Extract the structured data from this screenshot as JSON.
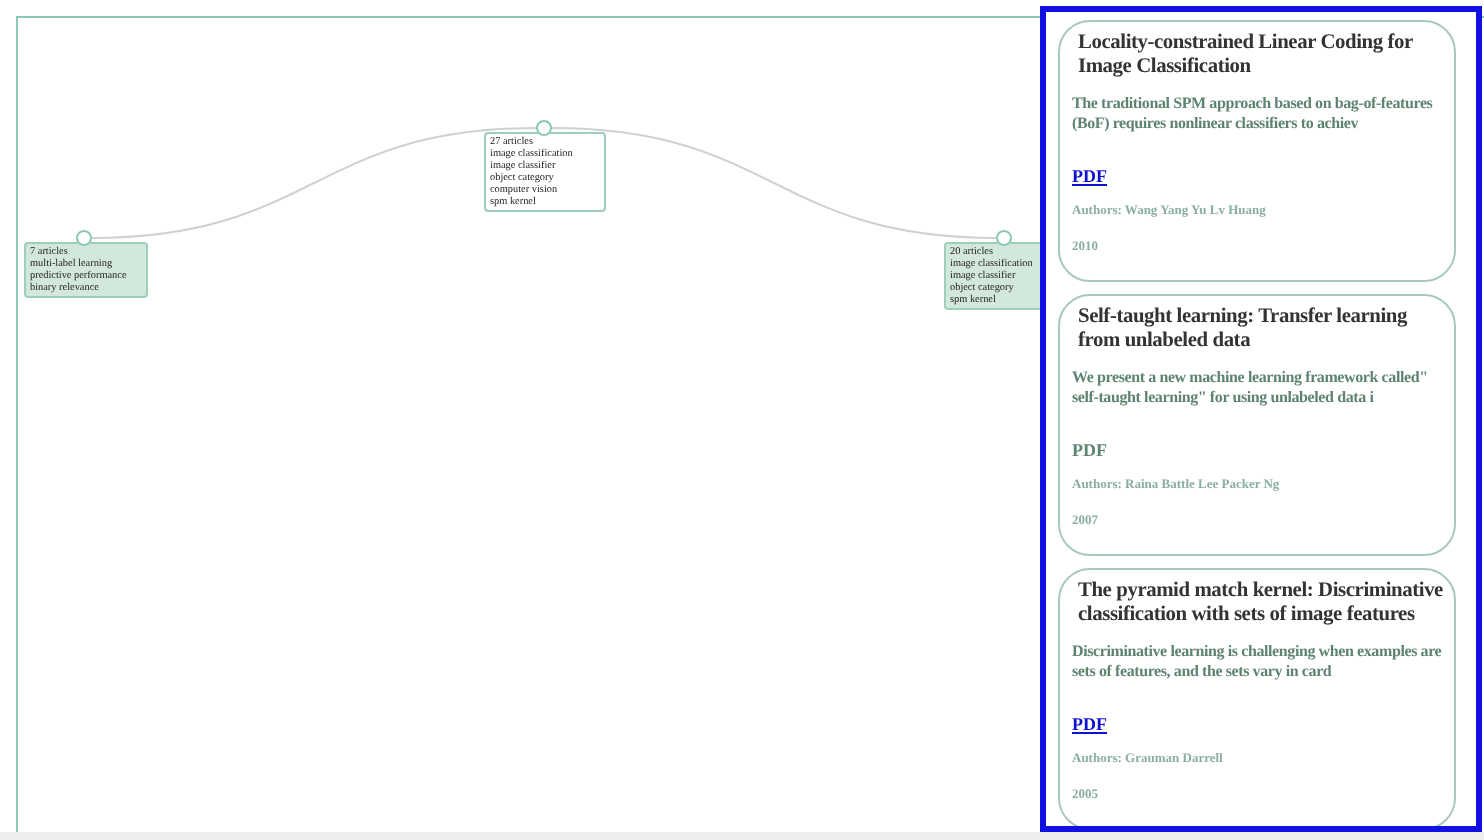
{
  "clusters": [
    {
      "count": "7 articles",
      "terms": [
        "multi-label learning",
        "predictive performance",
        "binary relevance"
      ],
      "filled": true
    },
    {
      "count": "27 articles",
      "terms": [
        "image classification",
        "image classifier",
        "object category",
        "computer vision",
        "spm kernel"
      ],
      "filled": false
    },
    {
      "count": "20 articles",
      "terms": [
        "image classification",
        "image classifier",
        "object category",
        "spm kernel"
      ],
      "filled": true
    }
  ],
  "papers": [
    {
      "title": "Locality-constrained Linear Coding for Image Classification",
      "abstract": "The traditional SPM approach based on bag-of-features (BoF) requires nonlinear classifiers to achiev",
      "pdf": {
        "label": "PDF",
        "linked": true
      },
      "authors": "Authors: Wang Yang Yu Lv Huang",
      "year": "2010"
    },
    {
      "title": "Self-taught learning: Transfer learning from unlabeled data",
      "abstract": "We present a new machine learning framework called\" self-taught learning\" for using unlabeled data i",
      "pdf": {
        "label": "PDF",
        "linked": false
      },
      "authors": "Authors: Raina Battle Lee Packer Ng",
      "year": "2007"
    },
    {
      "title": "The pyramid match kernel: Discriminative classification with sets of image features",
      "abstract": "Discriminative learning is challenging when examples are sets of features, and the sets vary in card",
      "pdf": {
        "label": "PDF",
        "linked": true
      },
      "authors": "Authors: Grauman Darrell",
      "year": "2005"
    }
  ]
}
